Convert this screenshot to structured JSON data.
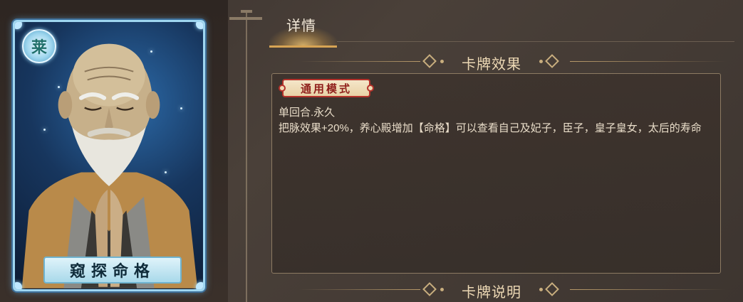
{
  "card": {
    "rank_glyph": "莱",
    "name": "窥探命格",
    "frame_color": "#9fd6f0"
  },
  "tabs": [
    {
      "label": "详情",
      "active": true
    }
  ],
  "sections": {
    "effect_title": "卡牌效果",
    "description_title": "卡牌说明"
  },
  "effect": {
    "mode_label": "通用模式",
    "lines": [
      "单回合.永久",
      "把脉效果+20%，养心殿增加【命格】可以查看自己及妃子，臣子，皇子皇女，太后的寿命"
    ]
  },
  "colors": {
    "accent_gold": "#d7a454",
    "mode_tag_red": "#b4322b",
    "text_light": "#e9ddc9"
  }
}
